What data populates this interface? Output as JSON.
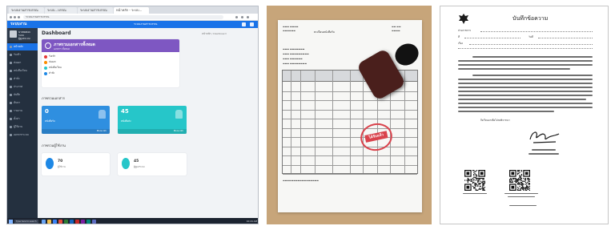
{
  "dashboard": {
    "browser_tabs": [
      "ระบบงานสารบรรณ",
      "ระบบ...บรรณ",
      "ระบบงานสารบรรณ",
      "หน้าหลัก - ระบบ..."
    ],
    "address": "ระบบงานสารบรรณ",
    "brand": "ระบบงาน",
    "user_name": "นายทดสอบ ระบบ",
    "user_role": "ผู้ดูแลระบบ",
    "menu_items": [
      "หน้าหลัก",
      "รับเข้า",
      "ส่งออก",
      "หนังสือเวียน",
      "คำสั่ง",
      "ประกาศ",
      "บันทึก",
      "ค้นหา",
      "รายงาน",
      "ตั้งค่า",
      "ผู้ใช้งาน",
      "ออกจากระบบ"
    ],
    "topbar_title": "ระบบงานสารบรรณ",
    "page_title": "Dashboard",
    "breadcrumb": "หน้าหลัก / Dashboard",
    "hero_title": "ภาพรวมเอกสารทั้งหมด",
    "hero_subtitle": "เอกสาร ทั้งหมด",
    "legend": [
      "รับเข้า",
      "ส่งออก",
      "หนังสือเวียน",
      "คำสั่ง"
    ],
    "section_stats": "ภาพรวมเอกสาร",
    "stats": [
      {
        "value": "0",
        "label": "หนังสือรับ",
        "more": "More info"
      },
      {
        "value": "45",
        "label": "หนังสือส่ง",
        "more": "More info"
      }
    ],
    "section_users": "ภาพรวมผู้ใช้งาน",
    "mini": [
      {
        "value": "70",
        "label": "ผู้ใช้งาน"
      },
      {
        "value": "45",
        "label": "ผู้ดูแลระบบ"
      }
    ],
    "taskbar_search": "Type here to search",
    "clock": "10:24 AM"
  },
  "colors": {
    "primary": "#1a73e8",
    "purple": "#7e57c2",
    "blue_card": "#2f8fe0",
    "teal_card": "#26c6c9",
    "stamp_red": "#d9434c"
  },
  "stamped_sheet": {
    "title": "ทะเบียนหนังสือรับ",
    "stamp_text": "ได้รับแล้ว"
  },
  "memo": {
    "title": "บันทึกข้อความ",
    "fields": [
      "ส่วนราชการ",
      "ที่",
      "วันที่",
      "เรื่อง"
    ],
    "closing": "จึงเรียนมาเพื่อโปรดพิจารณา"
  }
}
